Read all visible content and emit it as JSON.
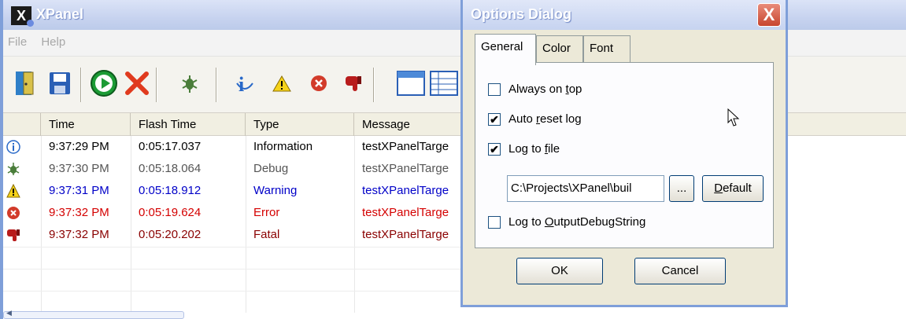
{
  "window": {
    "title": "XPanel",
    "logo_letter": "X"
  },
  "menu": [
    "File",
    "Help"
  ],
  "toolbar": {
    "icons": [
      "exit-door-icon",
      "save-disk-icon",
      "start-play-icon",
      "stop-x-icon",
      "debug-bug-icon",
      "information-icon",
      "warning-icon",
      "error-icon",
      "fatal-thumbs-down-icon",
      "window-icon",
      "grid-view-icon"
    ]
  },
  "table": {
    "columns": [
      "Time",
      "Flash Time",
      "Type",
      "Message"
    ],
    "rows": [
      {
        "icon": "information-icon",
        "time": "9:37:29 PM",
        "flash": "0:05:17.037",
        "type": "Information",
        "message": "testXPanelTarge",
        "color": "#000000"
      },
      {
        "icon": "debug-bug-icon",
        "time": "9:37:30 PM",
        "flash": "0:05:18.064",
        "type": "Debug",
        "message": "testXPanelTarge",
        "color": "#555555"
      },
      {
        "icon": "warning-icon",
        "time": "9:37:31 PM",
        "flash": "0:05:18.912",
        "type": "Warning",
        "message": "testXPanelTarge",
        "color": "#0000c8"
      },
      {
        "icon": "error-icon",
        "time": "9:37:32 PM",
        "flash": "0:05:19.624",
        "type": "Error",
        "message": "testXPanelTarge",
        "color": "#d40000"
      },
      {
        "icon": "fatal-thumbs-down-icon",
        "time": "9:37:32 PM",
        "flash": "0:05:20.202",
        "type": "Fatal",
        "message": "testXPanelTarge",
        "color": "#8a0000"
      }
    ]
  },
  "dialog": {
    "title": "Options Dialog",
    "close": "X",
    "tabs": [
      "General",
      "Color",
      "Font"
    ],
    "active_tab": "General",
    "options": {
      "always_on_top": {
        "pre": "Always on ",
        "u": "t",
        "post": "op",
        "checked": false
      },
      "auto_reset": {
        "pre": "Auto ",
        "u": "r",
        "post": "eset log",
        "checked": true
      },
      "log_file": {
        "pre": "Log to ",
        "u": "f",
        "post": "ile",
        "checked": true
      },
      "output_debug": {
        "pre": "Log to ",
        "u": "O",
        "post": "utputDebugString",
        "checked": false
      }
    },
    "path_value": "C:\\Projects\\XPanel\\buil",
    "browse_label": "...",
    "default_label": {
      "u": "D",
      "post": "efault"
    },
    "ok_label": "OK",
    "cancel_label": "Cancel",
    "check_mark": "✔"
  }
}
